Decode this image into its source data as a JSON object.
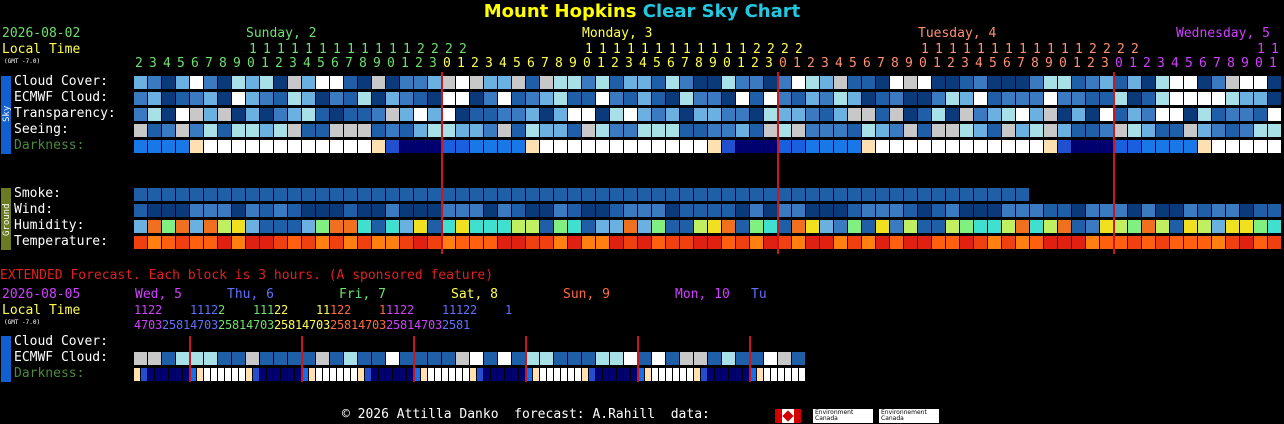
{
  "title": {
    "part1": "Mount Hopkins",
    "part2": "Clear Sky Chart",
    "color1": "#ffff00",
    "color2": "#22c8e0"
  },
  "header": {
    "date": "2026-08-02",
    "local_time": "Local Time",
    "gmt": "(GMT -7.0)",
    "days": [
      {
        "label": "Sunday, 2",
        "color": "#6ee06e"
      },
      {
        "label": "Monday, 3",
        "color": "#ffff50"
      },
      {
        "label": "Tuesday, 4",
        "color": "#ff9070"
      },
      {
        "label": "Wednesday, 5",
        "color": "#d040ff"
      }
    ],
    "tens_sun": "1111111111112222",
    "tens_mon": "1111111111112222",
    "tens_tue": "1111111111112222",
    "tens_wed": "11",
    "hours": "234567890123456789012301234567890123456789012301234567890123456789012301234567890123456789012301234567890123456789012301234567890123456789012301"
  },
  "sky_tab": "Sky",
  "ground_tab": "Ground",
  "rows": {
    "cloud_cover": "Cloud Cover:",
    "ecmwf_cloud": "ECMWF Cloud:",
    "transparency": "Transparency:",
    "seeing": "Seeing:",
    "darkness": "Darkness:",
    "smoke": "Smoke:",
    "wind": "Wind:",
    "humidity": "Humidity:",
    "temperature": "Temperature:"
  },
  "extended": {
    "note": "EXTENDED Forecast. Each block is 3 hours. (A sponsored feature)",
    "date": "2026-08-05",
    "local_time": "Local Time",
    "gmt": "(GMT -7.0)",
    "days": [
      {
        "label": "Wed, 5",
        "color": "#d040ff"
      },
      {
        "label": "Thu, 6",
        "color": "#6070ff"
      },
      {
        "label": "Fri, 7",
        "color": "#6ee06e"
      },
      {
        "label": "Sat, 8",
        "color": "#ffff50"
      },
      {
        "label": "Sun, 9",
        "color": "#ff6a40"
      },
      {
        "label": "Mon, 10",
        "color": "#d040ff"
      },
      {
        "label": "Tu",
        "color": "#6070ff"
      }
    ],
    "tens_line": "1122    11122    11122    11122    11122    11122    1",
    "hours_line": "470325814703258147032581470325814703258147032581",
    "cloud_cover": "Cloud Cover:",
    "ecmwf_cloud": "ECMWF Cloud:",
    "darkness": "Darkness:"
  },
  "footer": {
    "text": "© 2026 Attilla Danko  forecast: A.Rahill  data:",
    "logo1": "Environment Canada",
    "logo2": "Environnement Canada"
  },
  "colors": {
    "label_yellow": "#ffff00",
    "label_green": "#6ee06e",
    "darkness_label": "#4a8a3a",
    "extended_note": "#e02020",
    "separator": "#c8181c",
    "sky_tab": "#1060d0",
    "ground_tab": "#6a7a20"
  }
}
